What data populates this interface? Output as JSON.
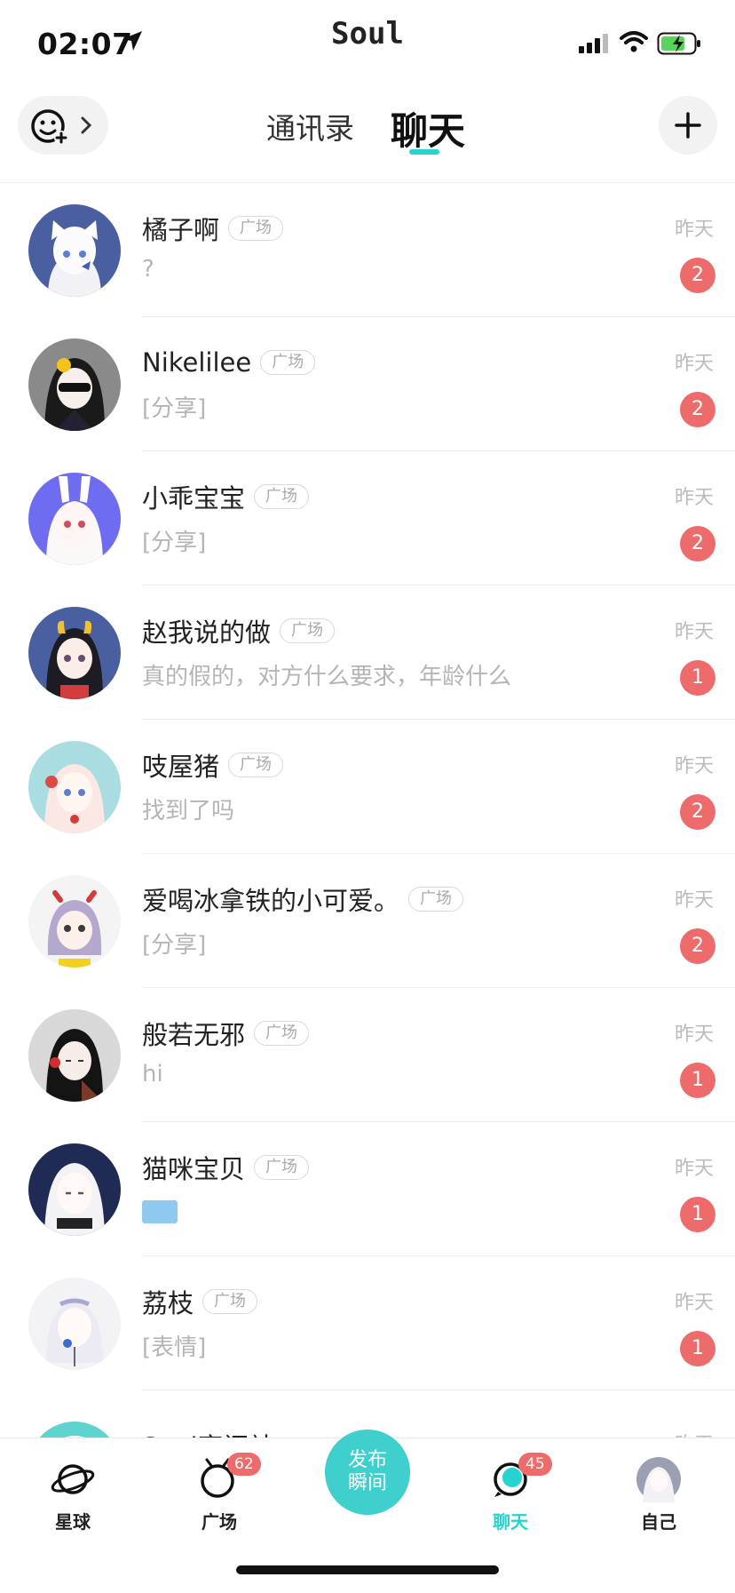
{
  "status_bar": {
    "time": "02:07",
    "app_name": "Soul"
  },
  "header": {
    "tabs": [
      {
        "label": "通讯录"
      },
      {
        "label": "聊天"
      }
    ],
    "active_tab": "聊天",
    "accent_color": "#25d4d0"
  },
  "chats": [
    {
      "name": "橘子啊",
      "tag": "广场",
      "preview": "?",
      "date": "昨天",
      "unread": "2",
      "avatar_color": "#4a5fa0"
    },
    {
      "name": "Nikelilee",
      "tag": "广场",
      "preview": "[分享]",
      "date": "昨天",
      "unread": "2",
      "avatar_color": "#8a8a8a"
    },
    {
      "name": "小乖宝宝",
      "tag": "广场",
      "preview": "[分享]",
      "date": "昨天",
      "unread": "2",
      "avatar_color": "#6e6cf0"
    },
    {
      "name": "赵我说的做",
      "tag": "广场",
      "preview": "真的假的，对方什么要求，年龄什么",
      "date": "昨天",
      "unread": "1",
      "avatar_color": "#4a5fa0"
    },
    {
      "name": "吱屋猪",
      "tag": "广场",
      "preview": "找到了吗",
      "date": "昨天",
      "unread": "2",
      "avatar_color": "#a9dde2"
    },
    {
      "name": "爱喝冰拿铁的小可爱。",
      "tag": "广场",
      "preview": "[分享]",
      "date": "昨天",
      "unread": "2",
      "avatar_color": "#f4f4f4"
    },
    {
      "name": "般若无邪",
      "tag": "广场",
      "preview": "hi",
      "date": "昨天",
      "unread": "1",
      "avatar_color": "#d8d8d8"
    },
    {
      "name": "猫咪宝贝",
      "tag": "广场",
      "preview": "",
      "date": "昨天",
      "unread": "1",
      "avatar_color": "#1f2a55"
    },
    {
      "name": "荔枝",
      "tag": "广场",
      "preview": "[表情]",
      "date": "昨天",
      "unread": "1",
      "avatar_color": "#f3f3f6"
    }
  ],
  "partial_chat": {
    "name": "Soul客间站",
    "date": "昨天"
  },
  "bottom_nav": {
    "items": [
      {
        "label": "星球",
        "badge": ""
      },
      {
        "label": "广场",
        "badge": "62"
      },
      {
        "label": "发布瞬间",
        "badge": ""
      },
      {
        "label": "聊天",
        "badge": "45"
      },
      {
        "label": "自己",
        "badge": ""
      }
    ],
    "publish_line1": "发布",
    "publish_line2": "瞬间",
    "active_color": "#25d4d0"
  }
}
